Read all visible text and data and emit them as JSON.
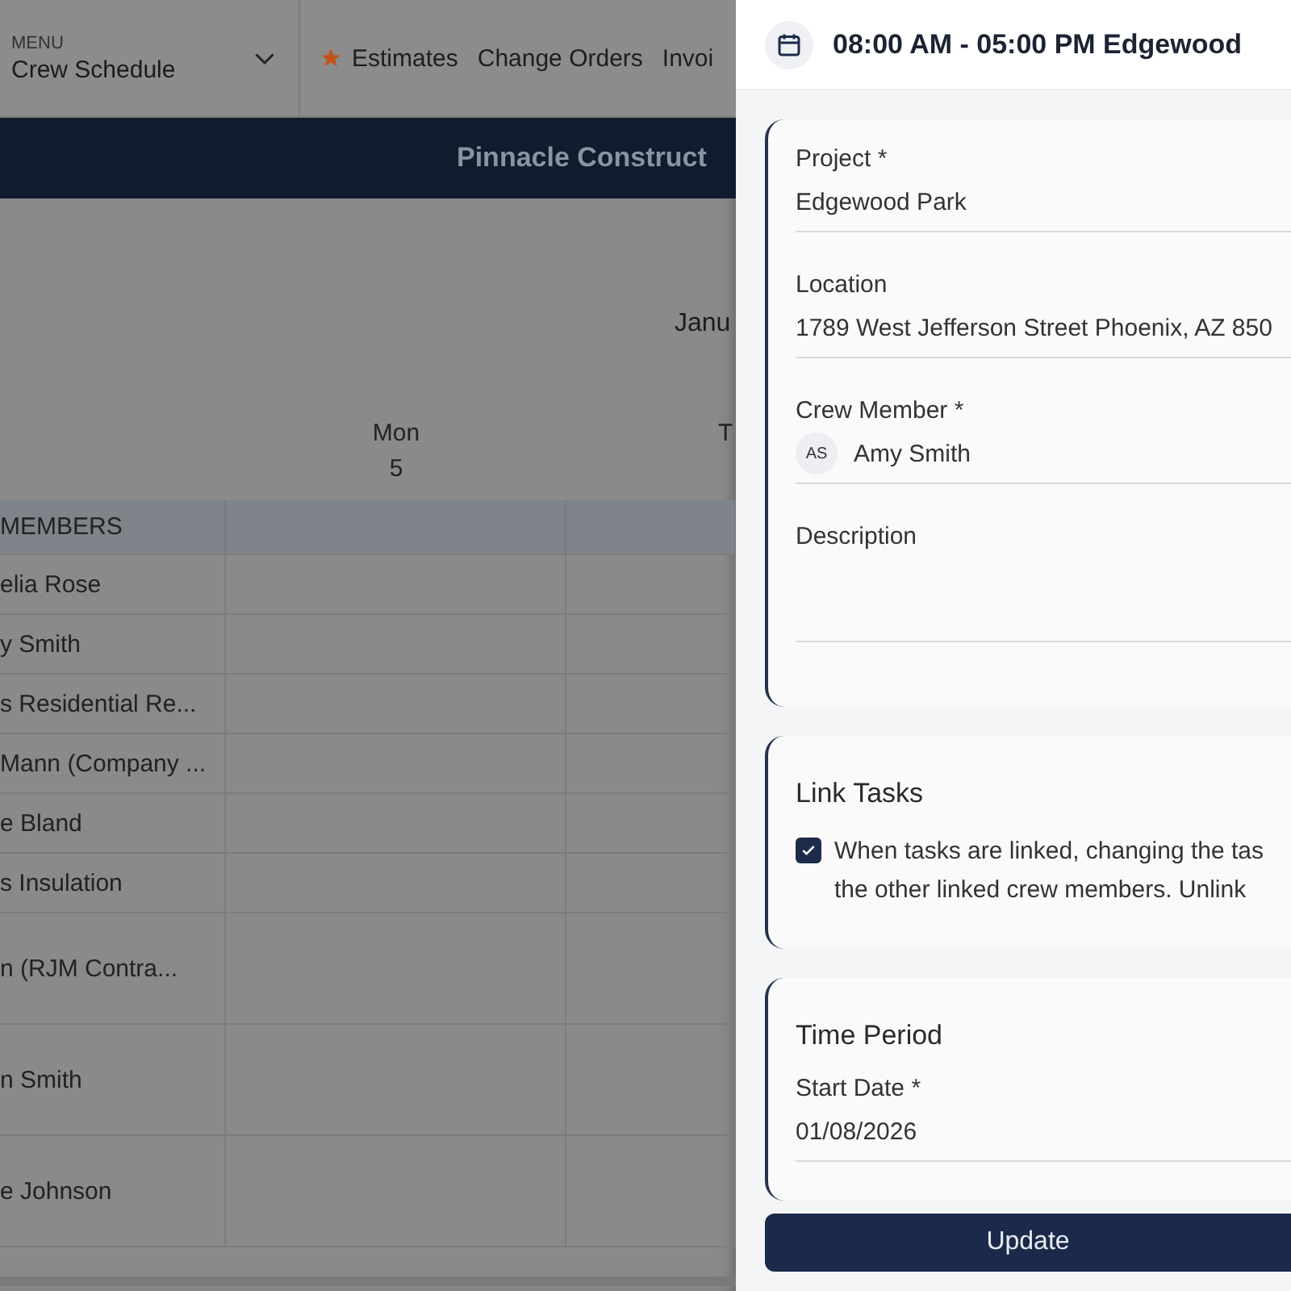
{
  "app": {
    "menu": {
      "label": "MENU",
      "value": "Crew Schedule"
    },
    "nav": [
      {
        "label": "Estimates",
        "starred": true
      },
      {
        "label": "Change Orders",
        "starred": false
      },
      {
        "label": "Invoi",
        "starred": false
      }
    ],
    "banner": "Pinnacle Construct",
    "month": "Janu",
    "days": [
      {
        "name": "Mon",
        "date": "5"
      },
      {
        "name": "T"
      }
    ],
    "group": "MEMBERS",
    "members": [
      {
        "name": "elia Rose",
        "kind": "short"
      },
      {
        "name": "y Smith",
        "kind": "short"
      },
      {
        "name": "s Residential Re...",
        "kind": "short"
      },
      {
        "name": "Mann (Company ...",
        "kind": "short"
      },
      {
        "name": "e Bland",
        "kind": "short"
      },
      {
        "name": "s Insulation",
        "kind": "short"
      },
      {
        "name": "n (RJM Contra...",
        "kind": "tall"
      },
      {
        "name": "n Smith",
        "kind": "tall"
      },
      {
        "name": "e Johnson",
        "kind": "tall"
      }
    ]
  },
  "drawer": {
    "title": "08:00 AM - 05:00 PM Edgewood",
    "details": [
      {
        "label": "Project *",
        "value": "Edgewood Park",
        "kind": "text"
      },
      {
        "label": "Location",
        "value": "1789 West Jefferson Street Phoenix, AZ 850",
        "kind": "text"
      },
      {
        "label": "Crew Member *",
        "value": "Amy Smith",
        "initials": "AS",
        "kind": "person"
      },
      {
        "label": "Description",
        "kind": "area"
      }
    ],
    "link_tasks": {
      "title": "Link Tasks",
      "checked": true,
      "lines": [
        "When tasks are linked, changing the tas",
        "the other linked crew members. Unlink"
      ]
    },
    "time_period": {
      "title": "Time Period",
      "fields": [
        {
          "label": "Start Date *",
          "value": "01/08/2026",
          "kind": "text"
        }
      ]
    },
    "button": "Update"
  }
}
